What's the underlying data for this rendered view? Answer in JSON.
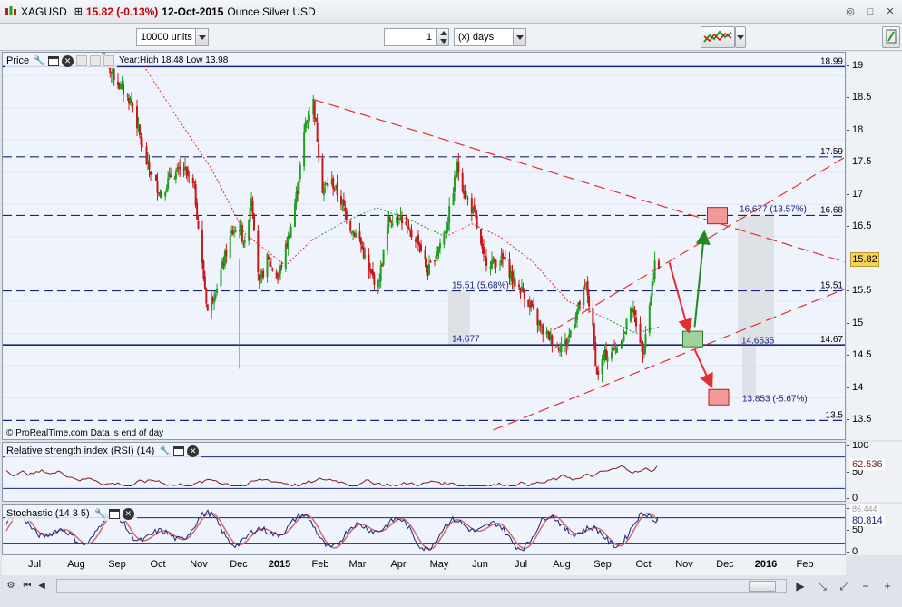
{
  "title_bar": {
    "symbol": "XAGUSD",
    "price_change": "15.82 (-0.13%)",
    "date": "12-Oct-2015",
    "name": "Ounce Silver USD"
  },
  "toolbar": {
    "units_value": "10000 units",
    "period_count": "1",
    "period_unit": "(x) days"
  },
  "price_panel": {
    "label": "Price",
    "year_info": "Year:High 18.48 Low 13.98",
    "footer": "© ProRealTime.com  Data is end of day",
    "current_price": "15.82",
    "y_ticks": [
      "19",
      "18.5",
      "18",
      "17.5",
      "17",
      "16.5",
      "16",
      "15.5",
      "15",
      "14.5",
      "14",
      "13.5"
    ],
    "hline_labels": [
      "18.99",
      "17.59",
      "16.68",
      "15.51",
      "14.67",
      "13.5"
    ],
    "annotations": {
      "target_up": "16.677 (13.57%)",
      "target_down": "13.853 (-5.67%)",
      "level_left": "15.51 (5.68%)",
      "level_mid": "14.677",
      "level_right": "14.6535"
    }
  },
  "rsi_panel": {
    "label": "Relative strength index (RSI) (14)",
    "value": "62.536",
    "y_ticks": [
      "100",
      "50",
      "0"
    ]
  },
  "stoch_panel": {
    "label": "Stochastic (14 3 5)",
    "value_top": "86.444",
    "value": "80.814",
    "y_ticks": [
      "100",
      "50",
      "0"
    ]
  },
  "x_axis": {
    "labels": [
      "Jul",
      "Aug",
      "Sep",
      "Oct",
      "Nov",
      "Dec",
      "2015",
      "Feb",
      "Mar",
      "Apr",
      "May",
      "Jun",
      "Jul",
      "Aug",
      "Sep",
      "Oct",
      "Nov",
      "Dec",
      "2016",
      "Feb"
    ],
    "bold": [
      "2015",
      "2016"
    ]
  },
  "colors": {
    "bull": "#1f9e1f",
    "bear": "#c41a1a",
    "resistance": "#e03030",
    "level": "#1a237e",
    "rsi": "#7a1f1f",
    "stoch_k": "#1a237e",
    "stoch_d": "#d36a6a"
  },
  "chart_data": [
    {
      "type": "candlestick",
      "title": "XAGUSD",
      "ylim": [
        13.35,
        19.15
      ],
      "x_range": [
        "Jul 2014",
        "Feb 2016"
      ],
      "horizontal_levels": [
        18.99,
        17.59,
        16.68,
        15.51,
        14.67,
        13.5
      ],
      "close_path": [
        [
          "2014-08-20",
          19.15
        ],
        [
          "2014-09-05",
          18.6
        ],
        [
          "2014-09-12",
          18.4
        ],
        [
          "2014-09-20",
          17.6
        ],
        [
          "2014-09-28",
          17.2
        ],
        [
          "2014-10-03",
          17.0
        ],
        [
          "2014-10-10",
          17.3
        ],
        [
          "2014-10-20",
          17.4
        ],
        [
          "2014-10-28",
          17.1
        ],
        [
          "2014-11-03",
          15.9
        ],
        [
          "2014-11-07",
          15.2
        ],
        [
          "2014-11-14",
          15.6
        ],
        [
          "2014-11-25",
          16.4
        ],
        [
          "2014-12-01",
          16.5
        ],
        [
          "2014-12-05",
          16.2
        ],
        [
          "2014-12-10",
          17.0
        ],
        [
          "2014-12-16",
          15.6
        ],
        [
          "2014-12-22",
          16.0
        ],
        [
          "2014-12-30",
          15.7
        ],
        [
          "2015-01-08",
          16.4
        ],
        [
          "2015-01-14",
          17.1
        ],
        [
          "2015-01-20",
          18.1
        ],
        [
          "2015-01-26",
          18.45
        ],
        [
          "2015-02-02",
          17.1
        ],
        [
          "2015-02-09",
          17.2
        ],
        [
          "2015-02-16",
          16.9
        ],
        [
          "2015-02-23",
          16.5
        ],
        [
          "2015-03-02",
          16.3
        ],
        [
          "2015-03-09",
          15.8
        ],
        [
          "2015-03-16",
          15.6
        ],
        [
          "2015-03-24",
          16.6
        ],
        [
          "2015-04-01",
          16.7
        ],
        [
          "2015-04-08",
          16.4
        ],
        [
          "2015-04-15",
          16.3
        ],
        [
          "2015-04-22",
          15.8
        ],
        [
          "2015-04-30",
          16.2
        ],
        [
          "2015-05-06",
          16.5
        ],
        [
          "2015-05-14",
          17.45
        ],
        [
          "2015-05-20",
          17.0
        ],
        [
          "2015-05-27",
          16.7
        ],
        [
          "2015-06-03",
          16.0
        ],
        [
          "2015-06-10",
          15.95
        ],
        [
          "2015-06-18",
          16.0
        ],
        [
          "2015-06-25",
          15.65
        ],
        [
          "2015-07-02",
          15.5
        ],
        [
          "2015-07-09",
          15.2
        ],
        [
          "2015-07-16",
          14.9
        ],
        [
          "2015-07-22",
          14.8
        ],
        [
          "2015-07-28",
          14.65
        ],
        [
          "2015-08-04",
          14.7
        ],
        [
          "2015-08-12",
          15.2
        ],
        [
          "2015-08-19",
          15.6
        ],
        [
          "2015-08-24",
          14.9
        ],
        [
          "2015-08-27",
          14.2
        ],
        [
          "2015-09-02",
          14.5
        ],
        [
          "2015-09-09",
          14.6
        ],
        [
          "2015-09-16",
          14.8
        ],
        [
          "2015-09-21",
          15.3
        ],
        [
          "2015-09-24",
          15.1
        ],
        [
          "2015-09-30",
          14.6
        ],
        [
          "2015-10-05",
          15.3
        ],
        [
          "2015-10-09",
          15.95
        ],
        [
          "2015-10-12",
          15.82
        ]
      ],
      "moving_average": [
        [
          "2014-09-20",
          19.0
        ],
        [
          "2014-10-15",
          18.2
        ],
        [
          "2014-11-10",
          17.4
        ],
        [
          "2014-12-05",
          16.4
        ],
        [
          "2015-01-05",
          15.9
        ],
        [
          "2015-01-25",
          16.3
        ],
        [
          "2015-02-20",
          16.6
        ],
        [
          "2015-03-15",
          16.8
        ],
        [
          "2015-04-10",
          16.6
        ],
        [
          "2015-05-05",
          16.35
        ],
        [
          "2015-05-25",
          16.55
        ],
        [
          "2015-06-15",
          16.35
        ],
        [
          "2015-07-10",
          15.95
        ],
        [
          "2015-08-05",
          15.35
        ],
        [
          "2015-09-01",
          15.1
        ],
        [
          "2015-09-25",
          14.85
        ],
        [
          "2015-10-12",
          14.95
        ]
      ]
    },
    {
      "type": "line",
      "title": "Relative strength index (RSI) (14)",
      "ylim": [
        0,
        100
      ],
      "last": 62.536
    },
    {
      "type": "line",
      "title": "Stochastic (14 3 5)",
      "ylim": [
        0,
        100
      ],
      "last": 80.814
    }
  ]
}
